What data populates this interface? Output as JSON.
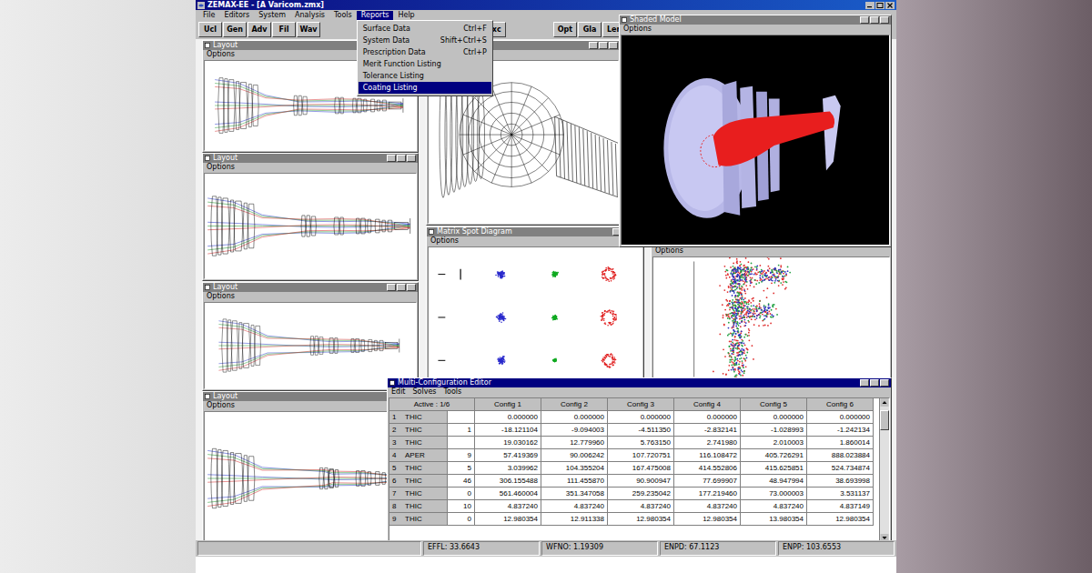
{
  "window": {
    "title": "ZEMAX-EE - [A Varicom.zmx]"
  },
  "menubar": [
    {
      "label": "File",
      "selected": false
    },
    {
      "label": "Editors",
      "selected": false
    },
    {
      "label": "System",
      "selected": false
    },
    {
      "label": "Analysis",
      "selected": false
    },
    {
      "label": "Tools",
      "selected": false
    },
    {
      "label": "Reports",
      "selected": true
    },
    {
      "label": "Help",
      "selected": false
    }
  ],
  "reports_menu": [
    {
      "label": "Surface Data",
      "shortcut": "Ctrl+F",
      "selected": false
    },
    {
      "label": "System Data",
      "shortcut": "Shift+Ctrl+S",
      "selected": false
    },
    {
      "label": "Prescription Data",
      "shortcut": "Ctrl+P",
      "selected": false
    },
    {
      "label": "Merit Function Listing",
      "shortcut": "",
      "selected": false
    },
    {
      "label": "Tolerance Listing",
      "shortcut": "",
      "selected": false
    },
    {
      "label": "Coating Listing",
      "shortcut": "",
      "selected": true
    }
  ],
  "toolbar": {
    "left": [
      "Ucl",
      "Gen",
      "Adv",
      "Fil",
      "Wav"
    ],
    "middle": [
      "Exc"
    ],
    "right": [
      "Opt",
      "Gla",
      "Len"
    ]
  },
  "layout_windows": [
    {
      "title": "Layout",
      "menu": "Options",
      "active": false
    },
    {
      "title": "Layout",
      "menu": "Options",
      "active": false
    },
    {
      "title": "Layout",
      "menu": "Options",
      "active": false
    },
    {
      "title": "Layout",
      "menu": "Options",
      "active": false
    }
  ],
  "layout_fields": [
    {
      "color": "#2233cc"
    },
    {
      "color": "#1f9a2a"
    },
    {
      "color": "#d42a2a"
    }
  ],
  "shaded_model": {
    "title": "Shaded Model",
    "menu": "Options",
    "active": false
  },
  "spot_diagram": {
    "title": "Matrix Spot Diagram",
    "menu": "Options",
    "active": false,
    "wavelengths": [
      {
        "color": "#2a2acc"
      },
      {
        "color": "#11aa22"
      },
      {
        "color": "#e02020"
      }
    ]
  },
  "image_analysis": {
    "menu": "Options",
    "wavelengths": [
      {
        "color": "#e03030"
      },
      {
        "color": "#20a040"
      },
      {
        "color": "#3030c0"
      }
    ]
  },
  "mce": {
    "title": "Multi-Configuration Editor",
    "active": true,
    "menu": [
      "Edit",
      "Solves",
      "Tools"
    ],
    "columns": [
      "Active : 1/6",
      "Config 1",
      "Config 2",
      "Config 3",
      "Config 4",
      "Config 5",
      "Config 6"
    ],
    "rows": [
      {
        "num": "1",
        "op": "THIC",
        "param": "",
        "values": [
          "0.000000",
          "0.000000",
          "0.000000",
          "0.000000",
          "0.000000",
          "0.000000"
        ]
      },
      {
        "num": "2",
        "op": "THIC",
        "param": "1",
        "values": [
          "-18.121104",
          "-9.094003",
          "-4.511350",
          "-2.832141",
          "-1.028993",
          "-1.242134"
        ]
      },
      {
        "num": "3",
        "op": "THIC",
        "param": "",
        "values": [
          "19.030162",
          "12.779960",
          "5.763150",
          "2.741980",
          "2.010003",
          "1.860014"
        ]
      },
      {
        "num": "4",
        "op": "APER",
        "param": "9",
        "values": [
          "57.419369",
          "90.006242",
          "107.720751",
          "116.108472",
          "405.726291",
          "888.023884"
        ]
      },
      {
        "num": "5",
        "op": "THIC",
        "param": "5",
        "values": [
          "3.039962",
          "104.355204",
          "167.475008",
          "414.552806",
          "415.625851",
          "524.734874"
        ]
      },
      {
        "num": "6",
        "op": "THIC",
        "param": "46",
        "values": [
          "306.155488",
          "111.455870",
          "90.900947",
          "77.699907",
          "48.947994",
          "38.693998"
        ]
      },
      {
        "num": "7",
        "op": "THIC",
        "param": "0",
        "values": [
          "561.460004",
          "351.347058",
          "259.235042",
          "177.219460",
          "73.000003",
          "3.531137"
        ]
      },
      {
        "num": "8",
        "op": "THIC",
        "param": "10",
        "values": [
          "4.837240",
          "4.837240",
          "4.837240",
          "4.837240",
          "4.837240",
          "4.837149"
        ]
      },
      {
        "num": "9",
        "op": "THIC",
        "param": "0",
        "values": [
          "12.980354",
          "12.911338",
          "12.980354",
          "12.980354",
          "13.980354",
          "12.980354"
        ]
      }
    ]
  },
  "status_bar": [
    "EFFL: 33.6643",
    "WFNO: 1.19309",
    "ENPD: 67.1123",
    "ENPP: 103.6553"
  ]
}
